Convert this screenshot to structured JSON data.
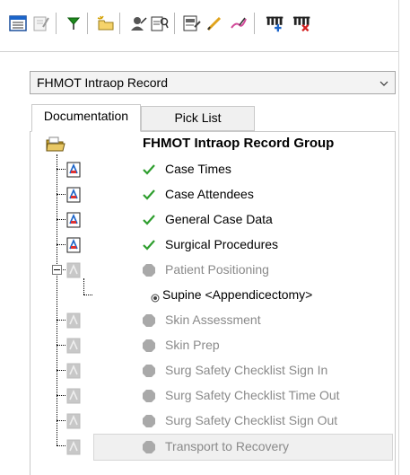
{
  "toolbar": {
    "buttons": [
      {
        "name": "grid-view-icon"
      },
      {
        "name": "edit-document-icon"
      },
      {
        "name": "flag-icon"
      },
      {
        "name": "new-folder-icon"
      },
      {
        "name": "person-icon"
      },
      {
        "name": "document-search-icon"
      },
      {
        "name": "document-chart-icon"
      },
      {
        "name": "pencil-icon"
      },
      {
        "name": "draw-icon"
      },
      {
        "name": "add-column-icon"
      },
      {
        "name": "remove-column-icon"
      }
    ]
  },
  "dropdown": {
    "value": "FHMOT Intraop Record"
  },
  "tabs": [
    {
      "label": "Documentation",
      "active": true
    },
    {
      "label": "Pick List",
      "active": false
    }
  ],
  "tree": {
    "group_label": "FHMOT Intraop Record Group",
    "items": [
      {
        "label": "Case Times",
        "status": "complete"
      },
      {
        "label": "Case Attendees",
        "status": "complete"
      },
      {
        "label": "General Case Data",
        "status": "complete"
      },
      {
        "label": "Surgical Procedures",
        "status": "complete"
      },
      {
        "label": "Patient Positioning",
        "status": "pending"
      },
      {
        "label": "Supine <Appendicectomy>",
        "status": "sub"
      },
      {
        "label": "Skin Assessment",
        "status": "pending"
      },
      {
        "label": "Skin Prep",
        "status": "pending"
      },
      {
        "label": "Surg Safety Checklist Sign In",
        "status": "pending"
      },
      {
        "label": "Surg Safety Checklist Time Out",
        "status": "pending"
      },
      {
        "label": "Surg Safety Checklist Sign Out",
        "status": "pending"
      },
      {
        "label": "Transport to Recovery",
        "status": "pending"
      }
    ]
  },
  "colors": {
    "check": "#2e9e2e",
    "pending": "#a9a9a9",
    "accent_blue": "#1b64c9"
  }
}
